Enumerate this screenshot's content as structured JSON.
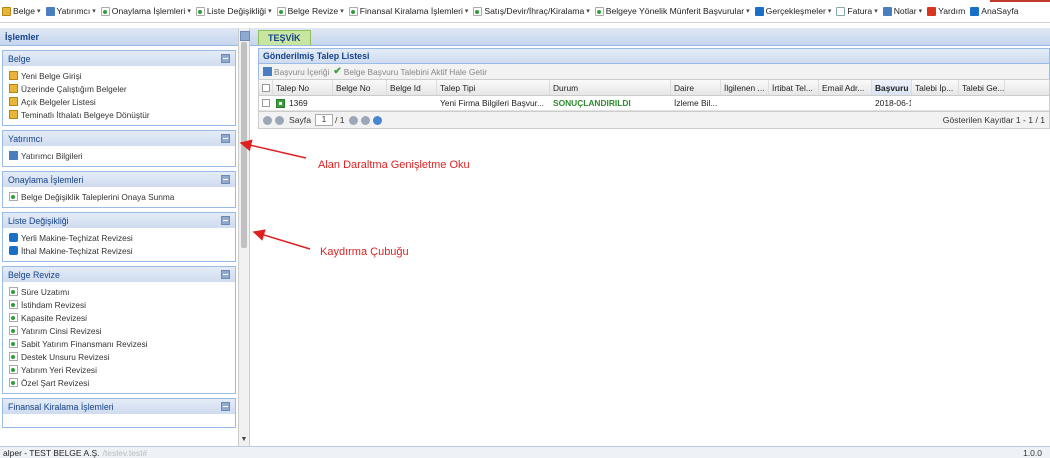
{
  "menubar": {
    "items": [
      {
        "label": "Belge",
        "icon": "yellow-doc-icon",
        "dropdown": true
      },
      {
        "label": "Yatırımcı",
        "icon": "chart-icon",
        "dropdown": true
      },
      {
        "label": "Onaylama İşlemleri",
        "icon": "green-doc-icon",
        "dropdown": true
      },
      {
        "label": "Liste Değişikliği",
        "icon": "green-doc-icon",
        "dropdown": true
      },
      {
        "label": "Belge Revize",
        "icon": "green-doc-icon",
        "dropdown": true
      },
      {
        "label": "Finansal Kiralama İşlemleri",
        "icon": "green-doc-icon",
        "dropdown": true
      },
      {
        "label": "Satış/Devir/İhraç/Kiralama",
        "icon": "green-doc-icon",
        "dropdown": true
      },
      {
        "label": "Belgeye Yönelik Münferit Başvurular",
        "icon": "green-doc-icon",
        "dropdown": true
      },
      {
        "label": "Gerçekleşmeler",
        "icon": "refresh-icon",
        "dropdown": true
      },
      {
        "label": "Fatura",
        "icon": "doc-icon",
        "dropdown": true
      },
      {
        "label": "Notlar",
        "icon": "notes-icon",
        "dropdown": true
      },
      {
        "label": "Yardım",
        "icon": "pdf-icon",
        "dropdown": false
      },
      {
        "label": "AnaSayfa",
        "icon": "home-icon",
        "dropdown": false
      }
    ]
  },
  "left": {
    "title": "İşlemler",
    "groups": [
      {
        "title": "Belge",
        "items": [
          {
            "label": "Yeni Belge Girişi",
            "icon": "yellow"
          },
          {
            "label": "Üzerinde Çalıştığım Belgeler",
            "icon": "yellow"
          },
          {
            "label": "Açık Belgeler Listesi",
            "icon": "yellow"
          },
          {
            "label": "Teminatlı İthalatı Belgeye Dönüştür",
            "icon": "yellow"
          }
        ]
      },
      {
        "title": "Yatırımcı",
        "items": [
          {
            "label": "Yatırımcı Bilgileri",
            "icon": "chart"
          }
        ]
      },
      {
        "title": "Onaylama İşlemleri",
        "items": [
          {
            "label": "Belge Değişiklik Taleplerini Onaya Sunma",
            "icon": "green"
          }
        ]
      },
      {
        "title": "Liste Değişikliği",
        "items": [
          {
            "label": "Yerli Makine-Teçhizat Revizesi",
            "icon": "blue"
          },
          {
            "label": "İthal Makine-Teçhizat Revizesi",
            "icon": "blue"
          }
        ]
      },
      {
        "title": "Belge Revize",
        "items": [
          {
            "label": "Süre Uzatımı",
            "icon": "green"
          },
          {
            "label": "İstihdam Revizesi",
            "icon": "green"
          },
          {
            "label": "Kapasite Revizesi",
            "icon": "green"
          },
          {
            "label": "Yatırım Cinsi Revizesi",
            "icon": "green"
          },
          {
            "label": "Sabit Yatırım Finansmanı Revizesi",
            "icon": "green"
          },
          {
            "label": "Destek Unsuru Revizesi",
            "icon": "green"
          },
          {
            "label": "Yatırım Yeri Revizesi",
            "icon": "green"
          },
          {
            "label": "Özel Şart Revizesi",
            "icon": "green"
          }
        ]
      },
      {
        "title": "Finansal Kiralama İşlemleri",
        "items": []
      }
    ]
  },
  "main": {
    "tab": "TEŞVİK",
    "panel_title": "Gönderilmiş Talep Listesi",
    "toolbar": {
      "view_label": "Başvuru İçeriği",
      "activate_label": "Belge Başvuru Talebini Aktif Hale Getir"
    },
    "columns": [
      "Talep No",
      "Belge No",
      "Belge Id",
      "Talep Tipi",
      "Durum",
      "Daire",
      "İlgilenen ...",
      "İrtibat Tel...",
      "Email Adr...",
      "Başvuru ...",
      "Talebi İp...",
      "Talebi Ge..."
    ],
    "rows": [
      [
        "1369",
        "",
        "",
        "Yeni Firma Bilgileri Başvur...",
        "SONUÇLANDIRILDI",
        "İzleme Bil...",
        "",
        "",
        "",
        "2018-06-1...",
        "",
        ""
      ]
    ],
    "pager": {
      "page_label": "Sayfa",
      "page_value": "1",
      "of_label": "/ 1",
      "records": "Gösterilen Kayıtlar 1 - 1 / 1"
    }
  },
  "annotations": {
    "collapse_arrow": "Alan Daraltma Genişletme Oku",
    "scrollbar": "Kaydırma Çubuğu"
  },
  "status": {
    "user": "alper - TEST BELGE A.Ş.",
    "url": "/teslev.test#",
    "version": "1.0.0"
  }
}
